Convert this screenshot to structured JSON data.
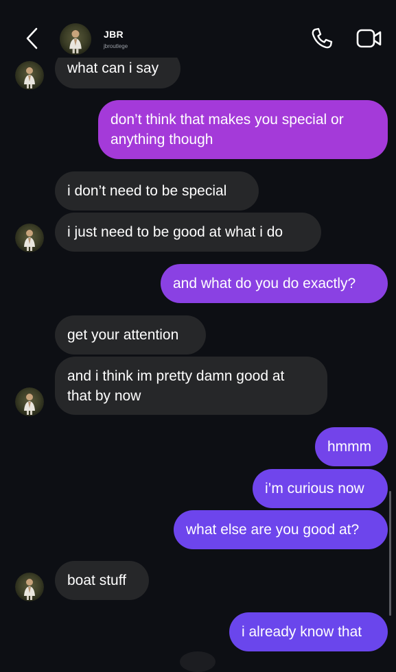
{
  "header": {
    "contact_name": "JBR",
    "contact_handle": "jbroutlege",
    "back_icon": "chevron-left-icon",
    "call_icon": "phone-icon",
    "video_icon": "video-camera-icon"
  },
  "colors": {
    "background": "#0d0f14",
    "incoming_bubble": "#262729",
    "outgoing_purple": "#a43ad9",
    "outgoing_violet": "#6d45ec"
  },
  "messages": [
    {
      "sender": "contact",
      "text": "what can i say"
    },
    {
      "sender": "me",
      "text_line1": "don’t think that makes you special or",
      "text_line2": "anything though"
    },
    {
      "sender": "contact",
      "text": "i don’t need to be special"
    },
    {
      "sender": "contact",
      "text": "i just need to be good at what i do"
    },
    {
      "sender": "me",
      "text": "and what do you do exactly?"
    },
    {
      "sender": "contact",
      "text": "get your attention"
    },
    {
      "sender": "contact",
      "text_line1": "and i think im pretty damn good at",
      "text_line2": "that by now"
    },
    {
      "sender": "me",
      "text": "hmmm"
    },
    {
      "sender": "me",
      "text": "i’m curious now"
    },
    {
      "sender": "me",
      "text": "what else are you good at?"
    },
    {
      "sender": "contact",
      "text": "boat stuff"
    },
    {
      "sender": "me",
      "text": "i already know that"
    }
  ]
}
